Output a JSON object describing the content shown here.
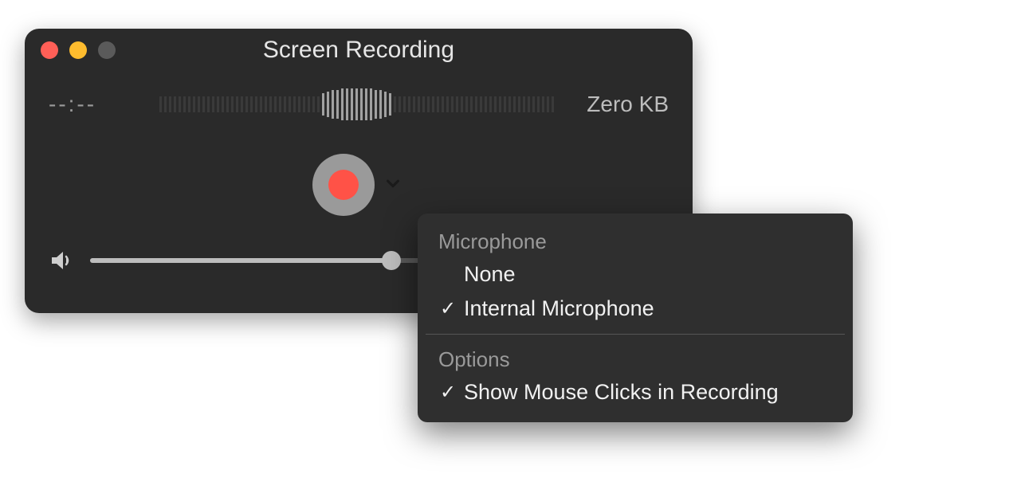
{
  "window": {
    "title": "Screen Recording"
  },
  "status": {
    "timecode": "--:--",
    "filesize": "Zero KB"
  },
  "menu": {
    "sections": [
      {
        "header": "Microphone",
        "items": [
          {
            "label": "None",
            "checked": false
          },
          {
            "label": "Internal Microphone",
            "checked": true
          }
        ]
      },
      {
        "header": "Options",
        "items": [
          {
            "label": "Show Mouse Clicks in Recording",
            "checked": true
          }
        ]
      }
    ]
  },
  "check_glyph": "✓"
}
